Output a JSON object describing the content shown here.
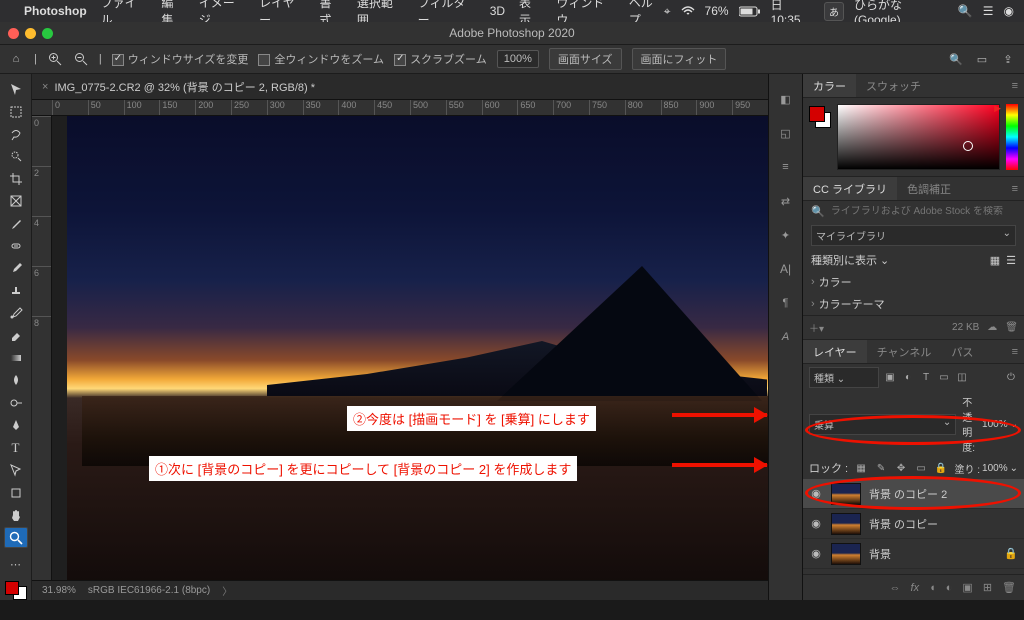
{
  "mac_menu": {
    "app": "Photoshop",
    "items": [
      "ファイル",
      "編集",
      "イメージ",
      "レイヤー",
      "書式",
      "選択範囲",
      "フィルター",
      "3D",
      "表示",
      "ウィンドウ",
      "ヘルプ"
    ],
    "battery": "76%",
    "clock": "日 10:35",
    "ime": "あ",
    "ime_label": "ひらがな (Google)"
  },
  "window_title": "Adobe Photoshop 2020",
  "options": {
    "resize": "ウィンドウサイズを変更",
    "zoom_all": "全ウィンドウをズーム",
    "scrubby": "スクラブズーム",
    "zoom_pct": "100%",
    "btn_canvas": "画面サイズ",
    "btn_fit": "画面にフィット"
  },
  "tab": {
    "name": "IMG_0775-2.CR2 @ 32% (背景 のコピー 2, RGB/8) *"
  },
  "ruler_h": [
    "0",
    "50",
    "100",
    "150",
    "200",
    "250",
    "300",
    "350",
    "400",
    "450",
    "500",
    "550",
    "600",
    "650",
    "700",
    "750",
    "800",
    "850",
    "900",
    "950"
  ],
  "ruler_v": [
    "0",
    "2",
    "4",
    "6",
    "8"
  ],
  "annotations": {
    "line1": "②今度は [描画モード] を [乗算] にします",
    "line2": "①次に [背景のコピー] を更にコピーして [背景のコピー 2] を作成します"
  },
  "status": {
    "zoom": "31.98%",
    "profile": "sRGB IEC61966-2.1 (8bpc)"
  },
  "panel_color": {
    "tab1": "カラー",
    "tab2": "スウォッチ"
  },
  "panel_lib": {
    "tab1": "CC ライブラリ",
    "tab2": "色調補正",
    "search_placeholder": "ライブラリおよび Adobe Stock を検索",
    "mylib": "マイライブラリ",
    "view": "種類別に表示",
    "group1": "カラー",
    "group2": "カラーテーマ",
    "size": "22 KB"
  },
  "panel_layers": {
    "tab1": "レイヤー",
    "tab2": "チャンネル",
    "tab3": "パス",
    "kind": "種類",
    "blend": "乗算",
    "opacity_label": "不透明度:",
    "opacity": "100%",
    "lock_label": "ロック :",
    "fill_label": "塗り :",
    "fill": "100%",
    "layers": [
      {
        "name": "背景 のコピー 2",
        "selected": true
      },
      {
        "name": "背景 のコピー",
        "selected": false
      },
      {
        "name": "背景",
        "selected": false
      }
    ]
  }
}
